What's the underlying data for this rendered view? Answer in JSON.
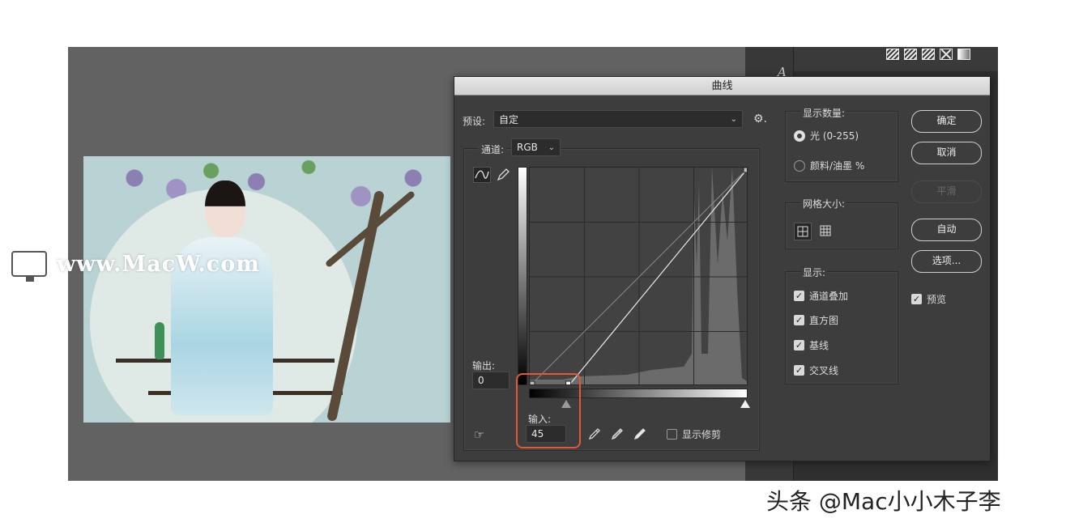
{
  "dialog": {
    "title": "曲线",
    "preset": {
      "label": "预设:",
      "value": "自定"
    },
    "channel": {
      "label": "通道:",
      "value": "RGB"
    },
    "output": {
      "label": "输出:",
      "value": "0"
    },
    "input": {
      "label": "输入:",
      "value": "45"
    },
    "show_clipping_label": "显示修剪",
    "display_amount": {
      "title": "显示数量:",
      "options": [
        {
          "label": "光 (0-255)",
          "selected": true
        },
        {
          "label": "颜料/油墨 %",
          "selected": false
        }
      ]
    },
    "grid_size": {
      "title": "网格大小:"
    },
    "show": {
      "title": "显示:",
      "options": [
        {
          "label": "通道叠加",
          "checked": true
        },
        {
          "label": "直方图",
          "checked": true
        },
        {
          "label": "基线",
          "checked": true
        },
        {
          "label": "交叉线",
          "checked": true
        }
      ]
    },
    "buttons": {
      "ok": "确定",
      "cancel": "取消",
      "smooth": "平滑",
      "auto": "自动",
      "options": "选项..."
    },
    "preview": {
      "label": "预览",
      "checked": true
    },
    "curve_points": [
      {
        "input": 0,
        "output": 0
      },
      {
        "input": 45,
        "output": 0
      },
      {
        "input": 255,
        "output": 255
      }
    ]
  },
  "watermarks": {
    "site": "www.MacW.com",
    "footer": "头条 @Mac小小木子李"
  },
  "colors": {
    "highlight": "#e15a37",
    "dialog_bg": "#3d3d3d"
  }
}
